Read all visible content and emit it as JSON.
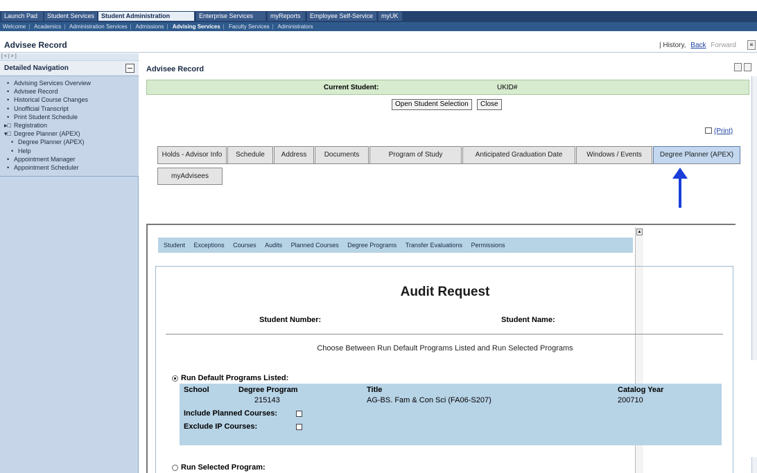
{
  "top_tabs": [
    "Launch Pad",
    "Student Services",
    "Student Administration",
    "Enterprise Services",
    "myReports",
    "Employee Self-Service",
    "myUK"
  ],
  "active_top_tab": "Student Administration",
  "sub_nav": [
    "Welcome",
    "Academics",
    "Administration Services",
    "Admissions",
    "Advising Services",
    "Faculty Services",
    "Administrators"
  ],
  "page_title": "Advisee Record",
  "history": {
    "label": "History",
    "back": "Back",
    "forward": "Forward"
  },
  "sidebar": {
    "handle": "[ < | > ]",
    "heading": "Detailed Navigation",
    "items": [
      {
        "label": "Advising Services Overview",
        "bullet": "•"
      },
      {
        "label": "Advisee Record",
        "bullet": "•"
      },
      {
        "label": "Historical Course Changes",
        "bullet": "•"
      },
      {
        "label": "Unofficial Transcript",
        "bullet": "•"
      },
      {
        "label": "Print Student Schedule",
        "bullet": "•"
      },
      {
        "label": "Registration",
        "bullet": "▸□"
      },
      {
        "label": "Degree Planner (APEX)",
        "bullet": "▾□"
      },
      {
        "label": "Degree Planner (APEX)",
        "bullet": "•"
      },
      {
        "label": "Help",
        "bullet": "•"
      },
      {
        "label": "Appointment Manager",
        "bullet": "•"
      },
      {
        "label": "Appointment Scheduler",
        "bullet": "•"
      }
    ]
  },
  "main": {
    "title": "Advisee Record",
    "current_student_label": "Current Student:",
    "ukid_label": "UKID#",
    "open_selection_button": "Open Student Selection",
    "close_button": "Close",
    "print_link": "(Print)",
    "tabs_row1": [
      "Holds - Advisor Info",
      "Schedule",
      "Address",
      "Documents",
      "Program of Study",
      "Anticipated Graduation Date",
      "Windows / Events",
      "Degree Planner (APEX)"
    ],
    "selected_tab": "Degree Planner (APEX)",
    "tabs_row2": [
      "myAdvisees"
    ],
    "arrow_color": "#1a3fd8"
  },
  "apex": {
    "nav": [
      "Student",
      "Exceptions",
      "Courses",
      "Audits",
      "Planned Courses",
      "Degree Programs",
      "Transfer Evaluations",
      "Permissions"
    ],
    "audit_title": "Audit Request",
    "student_number_label": "Student Number:",
    "student_name_label": "Student Name:",
    "choose_text": "Choose Between Run Default Programs Listed and Run Selected Programs",
    "run_default_label": "Run Default Programs Listed:",
    "run_default_selected": true,
    "headers": {
      "school": "School",
      "degree_program": "Degree Program",
      "title": "Title",
      "catalog_year": "Catalog Year"
    },
    "program": {
      "degree_program": "215143",
      "title": "AG-BS. Fam & Con Sci (FA06-S207)",
      "catalog_year": "200710"
    },
    "include_planned_label": "Include Planned Courses:",
    "include_planned_checked": false,
    "exclude_ip_label": "Exclude IP Courses:",
    "exclude_ip_checked": false,
    "run_selected_label": "Run Selected Program:",
    "run_selected_selected": false
  },
  "colors": {
    "nav_bg": "#24426e",
    "sidebar_bg": "#c6d6e8",
    "current_student_bg": "#d7ebcf",
    "program_bg": "#b7d3e6",
    "selected_tab_bg": "#c3d8ef"
  }
}
